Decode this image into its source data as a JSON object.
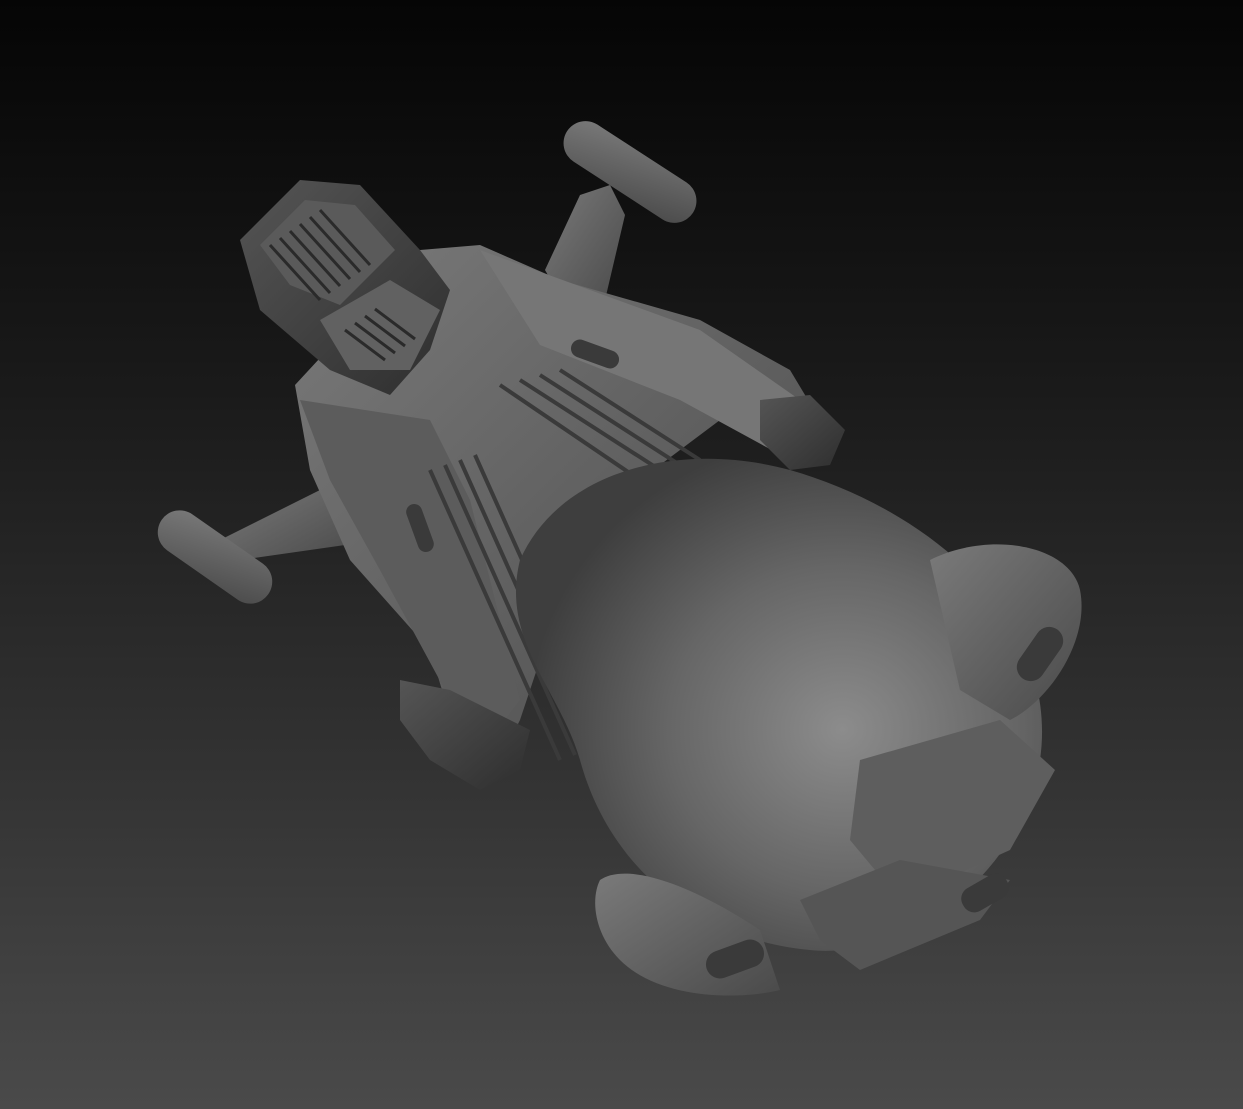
{
  "viewport": {
    "background_top": "#050505",
    "background_bottom": "#4a4a4a",
    "material_color": "#6e6e6e"
  },
  "model": {
    "kind": "hover-bike-sculpt",
    "shading": "grey clay"
  }
}
